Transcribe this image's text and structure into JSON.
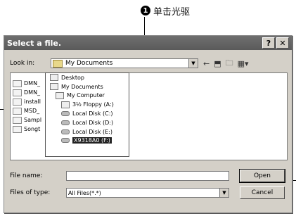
{
  "callout": {
    "number": "1",
    "text": "单击光驱"
  },
  "dialog": {
    "title": "Select a file.",
    "help_button": "?",
    "close_button": "✕"
  },
  "lookin": {
    "label": "Look in:",
    "value": "My Documents"
  },
  "toolbar": {
    "back_icon": "back-arrow-icon",
    "up_icon": "up-folder-icon",
    "new_folder_icon": "new-folder-icon",
    "view_icon": "view-menu-icon"
  },
  "file_list": [
    "DMN_",
    "DMN_",
    "install",
    "MSD_",
    "Sampl",
    "Songt"
  ],
  "dropdown_items": [
    {
      "label": "Desktop",
      "type": "folder"
    },
    {
      "label": "My Documents",
      "type": "folder"
    },
    {
      "label": "My Computer",
      "type": "computer"
    },
    {
      "label": "3½ Floppy (A:)",
      "type": "floppy"
    },
    {
      "label": "Local Disk (C:)",
      "type": "disk"
    },
    {
      "label": "Local Disk (D:)",
      "type": "disk"
    },
    {
      "label": "Local Disk (E:)",
      "type": "disk"
    },
    {
      "label": "X9318A0 (F:)",
      "type": "cdrom",
      "selected": true
    }
  ],
  "file_name": {
    "label": "File name:",
    "value": ""
  },
  "file_type": {
    "label": "Files of type:",
    "value": "All Files(*.*)"
  },
  "buttons": {
    "open": "Open",
    "cancel": "Cancel"
  },
  "colors": {
    "dialog_bg": "#d4d0c8",
    "title_bg": "#5a5a5a"
  }
}
